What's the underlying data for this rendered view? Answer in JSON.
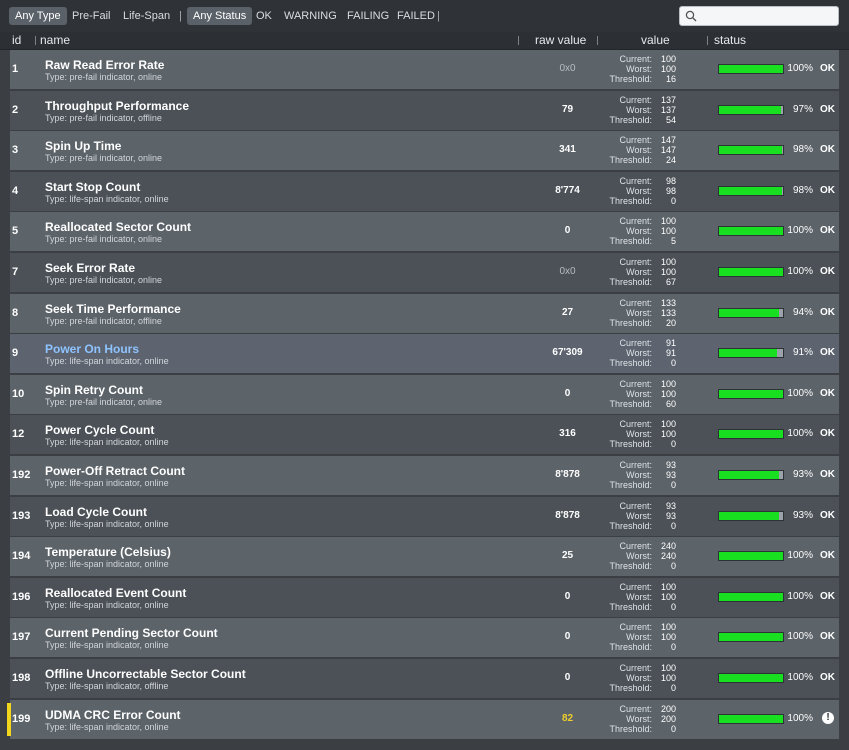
{
  "filters": {
    "type": [
      "Any Type",
      "Pre-Fail",
      "Life-Span"
    ],
    "status": [
      "Any Status",
      "OK",
      "WARNING",
      "FAILING",
      "FAILED"
    ],
    "separator": "|"
  },
  "search": {
    "placeholder": "",
    "value": ""
  },
  "columns": {
    "id": "id",
    "name": "name",
    "raw": "raw value",
    "value": "value",
    "status": "status"
  },
  "labels": {
    "current": "Current:",
    "worst": "Worst:",
    "threshold": "Threshold:"
  },
  "colors": {
    "bar_fill": "#18e021",
    "warning": "#f2d61c",
    "link": "#8ec3ff"
  },
  "rows": [
    {
      "id": "1",
      "name": "Raw Read Error Rate",
      "type": "Type: pre-fail indicator, online",
      "raw": "0x0",
      "current": "100",
      "worst": "100",
      "threshold": "16",
      "pct": "100%",
      "health": 1.0,
      "status": "OK"
    },
    {
      "id": "2",
      "name": "Throughput Performance",
      "type": "Type: pre-fail indicator, offline",
      "raw": "79",
      "current": "137",
      "worst": "137",
      "threshold": "54",
      "pct": "97%",
      "health": 0.97,
      "status": "OK"
    },
    {
      "id": "3",
      "name": "Spin Up Time",
      "type": "Type: pre-fail indicator, online",
      "raw": "341",
      "current": "147",
      "worst": "147",
      "threshold": "24",
      "pct": "98%",
      "health": 0.98,
      "status": "OK"
    },
    {
      "id": "4",
      "name": "Start Stop Count",
      "type": "Type: life-span indicator, online",
      "raw": "8'774",
      "current": "98",
      "worst": "98",
      "threshold": "0",
      "pct": "98%",
      "health": 0.98,
      "status": "OK"
    },
    {
      "id": "5",
      "name": "Reallocated Sector Count",
      "type": "Type: pre-fail indicator, online",
      "raw": "0",
      "current": "100",
      "worst": "100",
      "threshold": "5",
      "pct": "100%",
      "health": 1.0,
      "status": "OK"
    },
    {
      "id": "7",
      "name": "Seek Error Rate",
      "type": "Type: pre-fail indicator, online",
      "raw": "0x0",
      "current": "100",
      "worst": "100",
      "threshold": "67",
      "pct": "100%",
      "health": 1.0,
      "status": "OK"
    },
    {
      "id": "8",
      "name": "Seek Time Performance",
      "type": "Type: pre-fail indicator, offline",
      "raw": "27",
      "current": "133",
      "worst": "133",
      "threshold": "20",
      "pct": "94%",
      "health": 0.94,
      "status": "OK"
    },
    {
      "id": "9",
      "name": "Power On Hours",
      "type": "Type: life-span indicator, online",
      "raw": "67'309",
      "current": "91",
      "worst": "91",
      "threshold": "0",
      "pct": "91%",
      "health": 0.91,
      "status": "OK"
    },
    {
      "id": "10",
      "name": "Spin Retry Count",
      "type": "Type: pre-fail indicator, online",
      "raw": "0",
      "current": "100",
      "worst": "100",
      "threshold": "60",
      "pct": "100%",
      "health": 1.0,
      "status": "OK"
    },
    {
      "id": "12",
      "name": "Power Cycle Count",
      "type": "Type: life-span indicator, online",
      "raw": "316",
      "current": "100",
      "worst": "100",
      "threshold": "0",
      "pct": "100%",
      "health": 1.0,
      "status": "OK"
    },
    {
      "id": "192",
      "name": "Power-Off Retract Count",
      "type": "Type: life-span indicator, online",
      "raw": "8'878",
      "current": "93",
      "worst": "93",
      "threshold": "0",
      "pct": "93%",
      "health": 0.93,
      "status": "OK"
    },
    {
      "id": "193",
      "name": "Load Cycle Count",
      "type": "Type: life-span indicator, online",
      "raw": "8'878",
      "current": "93",
      "worst": "93",
      "threshold": "0",
      "pct": "93%",
      "health": 0.93,
      "status": "OK"
    },
    {
      "id": "194",
      "name": "Temperature (Celsius)",
      "type": "Type: life-span indicator, online",
      "raw": "25",
      "current": "240",
      "worst": "240",
      "threshold": "0",
      "pct": "100%",
      "health": 1.0,
      "status": "OK"
    },
    {
      "id": "196",
      "name": "Reallocated Event Count",
      "type": "Type: life-span indicator, online",
      "raw": "0",
      "current": "100",
      "worst": "100",
      "threshold": "0",
      "pct": "100%",
      "health": 1.0,
      "status": "OK"
    },
    {
      "id": "197",
      "name": "Current Pending Sector Count",
      "type": "Type: life-span indicator, online",
      "raw": "0",
      "current": "100",
      "worst": "100",
      "threshold": "0",
      "pct": "100%",
      "health": 1.0,
      "status": "OK"
    },
    {
      "id": "198",
      "name": "Offline Uncorrectable Sector Count",
      "type": "Type: life-span indicator, offline",
      "raw": "0",
      "current": "100",
      "worst": "100",
      "threshold": "0",
      "pct": "100%",
      "health": 1.0,
      "status": "OK"
    },
    {
      "id": "199",
      "name": "UDMA CRC Error Count",
      "type": "Type: life-span indicator, online",
      "raw": "82",
      "current": "200",
      "worst": "200",
      "threshold": "0",
      "pct": "100%",
      "health": 1.0,
      "status": "!",
      "warning": true
    }
  ]
}
